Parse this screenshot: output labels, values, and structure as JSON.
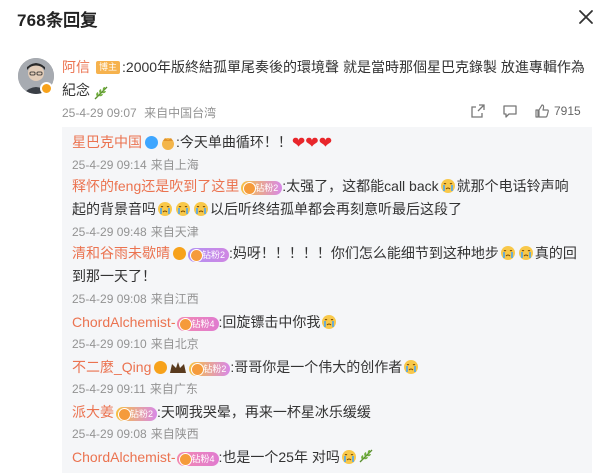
{
  "header": {
    "title": "768条回复"
  },
  "comment": {
    "username": "阿信",
    "tag": "博主",
    "text": ":2000年版終結孤單尾奏後的環境聲  就是當時那個星巴克錄製  放進專輯作為紀念",
    "date": "25-4-29 09:07",
    "location": "来自中国台湾",
    "likes": "7915"
  },
  "replies": [
    {
      "name": "星巴克中国",
      "text": ":今天单曲循环！！",
      "date": "25-4-29 09:14",
      "location": "来自上海"
    },
    {
      "name": "释怀的feng还是吹到了这里",
      "fan": "钻粉2",
      "text1": ":太强了，这都能call back",
      "text2": "就那个电话铃声响起的背景音吗",
      "text3": "以后听终结孤单都会再刻意听最后这段了",
      "date": "25-4-29 09:48",
      "location": "来自天津"
    },
    {
      "name": "清和谷雨未歇晴",
      "fan": "钻粉2",
      "text1": ":妈呀！！！！！你们怎么能细节到这种地步",
      "text2": "真的回到那一天了！",
      "date": "25-4-29 09:08",
      "location": "来自江西"
    },
    {
      "name": "ChordAlchemist-",
      "fan": "钻粉4",
      "text": ":回旋镖击中你我",
      "date": "25-4-29 09:10",
      "location": "来自北京"
    },
    {
      "name": "不二麼_Qing",
      "fan": "钻粉2",
      "text": ":哥哥你是一个伟大的创作者",
      "date": "25-4-29 09:11",
      "location": "来自广东"
    },
    {
      "name": "派大姜",
      "fan": "钻粉2",
      "text": ":天啊我哭晕，再来一杯星冰乐缓缓",
      "date": "25-4-29 09:08",
      "location": "来自陕西"
    },
    {
      "name": "ChordAlchemist-",
      "fan": "钻粉4",
      "text": ":也是一个25年 对吗"
    }
  ],
  "colors": {
    "username": "#eb7350",
    "meta": "#939393",
    "reply_bg": "#f5f6f8"
  }
}
